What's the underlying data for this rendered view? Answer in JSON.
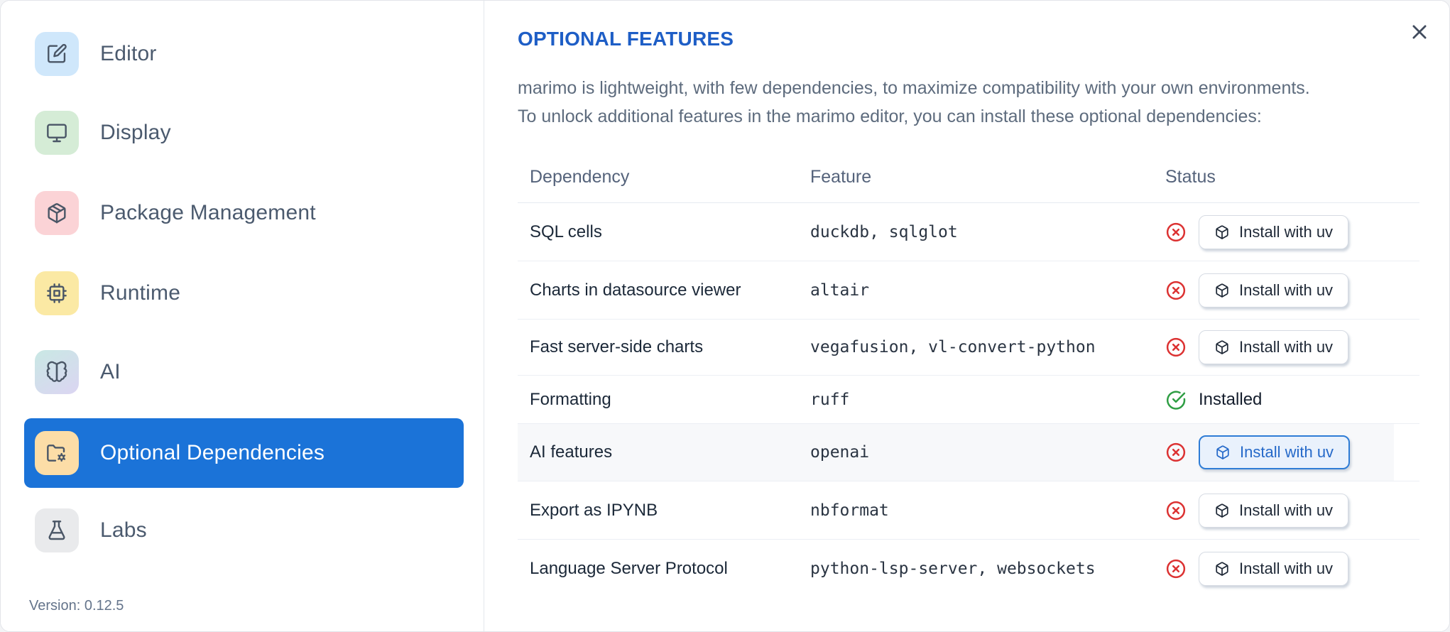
{
  "sidebar": {
    "items": [
      {
        "label": "Editor",
        "icon": "editor-pen-icon",
        "tile_color": "#cfe7fb"
      },
      {
        "label": "Display",
        "icon": "monitor-icon",
        "tile_color": "#d5ecd6"
      },
      {
        "label": "Package Management",
        "icon": "package-icon",
        "tile_color": "#fbd3d6"
      },
      {
        "label": "Runtime",
        "icon": "cpu-icon",
        "tile_color": "#fbe9a4"
      },
      {
        "label": "AI",
        "icon": "brain-icon",
        "tile_gradient": [
          "#c9e8e4",
          "#dbd5f2"
        ]
      },
      {
        "label": "Optional Dependencies",
        "icon": "folder-gear-icon",
        "tile_color": "#fcdda7",
        "selected": true
      },
      {
        "label": "Labs",
        "icon": "flask-icon",
        "tile_color": "#e9eaec"
      }
    ],
    "version": "Version: 0.12.5"
  },
  "main": {
    "title": "OPTIONAL FEATURES",
    "description_line1": "marimo is lightweight, with few dependencies, to maximize compatibility with your own environments.",
    "description_line2": "To unlock additional features in the marimo editor, you can install these optional dependencies:",
    "close_icon": "close-x-icon",
    "table": {
      "headers": [
        "Dependency",
        "Feature",
        "Status"
      ],
      "install_button_label": "Install with uv",
      "install_button_icon": "box-icon",
      "installed_label": "Installed",
      "rows": [
        {
          "dependency": "SQL cells",
          "feature": "duckdb, sqlglot",
          "status": "missing"
        },
        {
          "dependency": "Charts in datasource viewer",
          "feature": "altair",
          "status": "missing"
        },
        {
          "dependency": "Fast server-side charts",
          "feature": "vegafusion, vl-convert-python",
          "status": "missing"
        },
        {
          "dependency": "Formatting",
          "feature": "ruff",
          "status": "installed"
        },
        {
          "dependency": "AI features",
          "feature": "openai",
          "status": "missing",
          "highlighted": true
        },
        {
          "dependency": "Export as IPYNB",
          "feature": "nbformat",
          "status": "missing"
        },
        {
          "dependency": "Language Server Protocol",
          "feature": "python-lsp-server, websockets",
          "status": "missing"
        }
      ]
    }
  },
  "colors": {
    "accent_blue": "#1b73d8",
    "title_blue": "#1e5ec6",
    "danger_red": "#dc3232",
    "success_green": "#2f9e44",
    "hl_bg": "#e9f1fc",
    "hl_border": "#2e7cd6",
    "hl_text": "#2569c9"
  }
}
